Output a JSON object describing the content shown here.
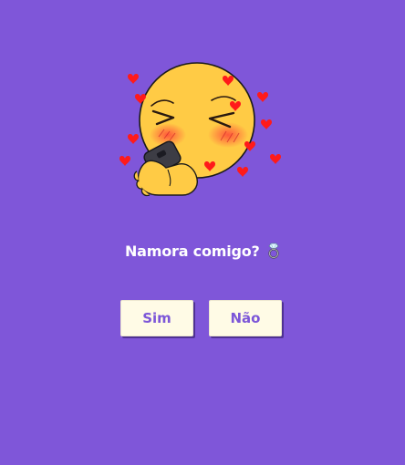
{
  "question": {
    "text": "Namora comigo?",
    "emoji_icon": "ring-icon"
  },
  "buttons": {
    "yes_label": "Sim",
    "no_label": "Não"
  },
  "sticker": {
    "icon": "blushing-emoji-with-phone-and-hearts"
  },
  "colors": {
    "background": "#7f56d9",
    "button_background": "#fffbe6",
    "button_text": "#7c56d8",
    "question_text": "#ffffff",
    "heart": "#ff1a1a",
    "emoji_face": "#ffcb45"
  }
}
